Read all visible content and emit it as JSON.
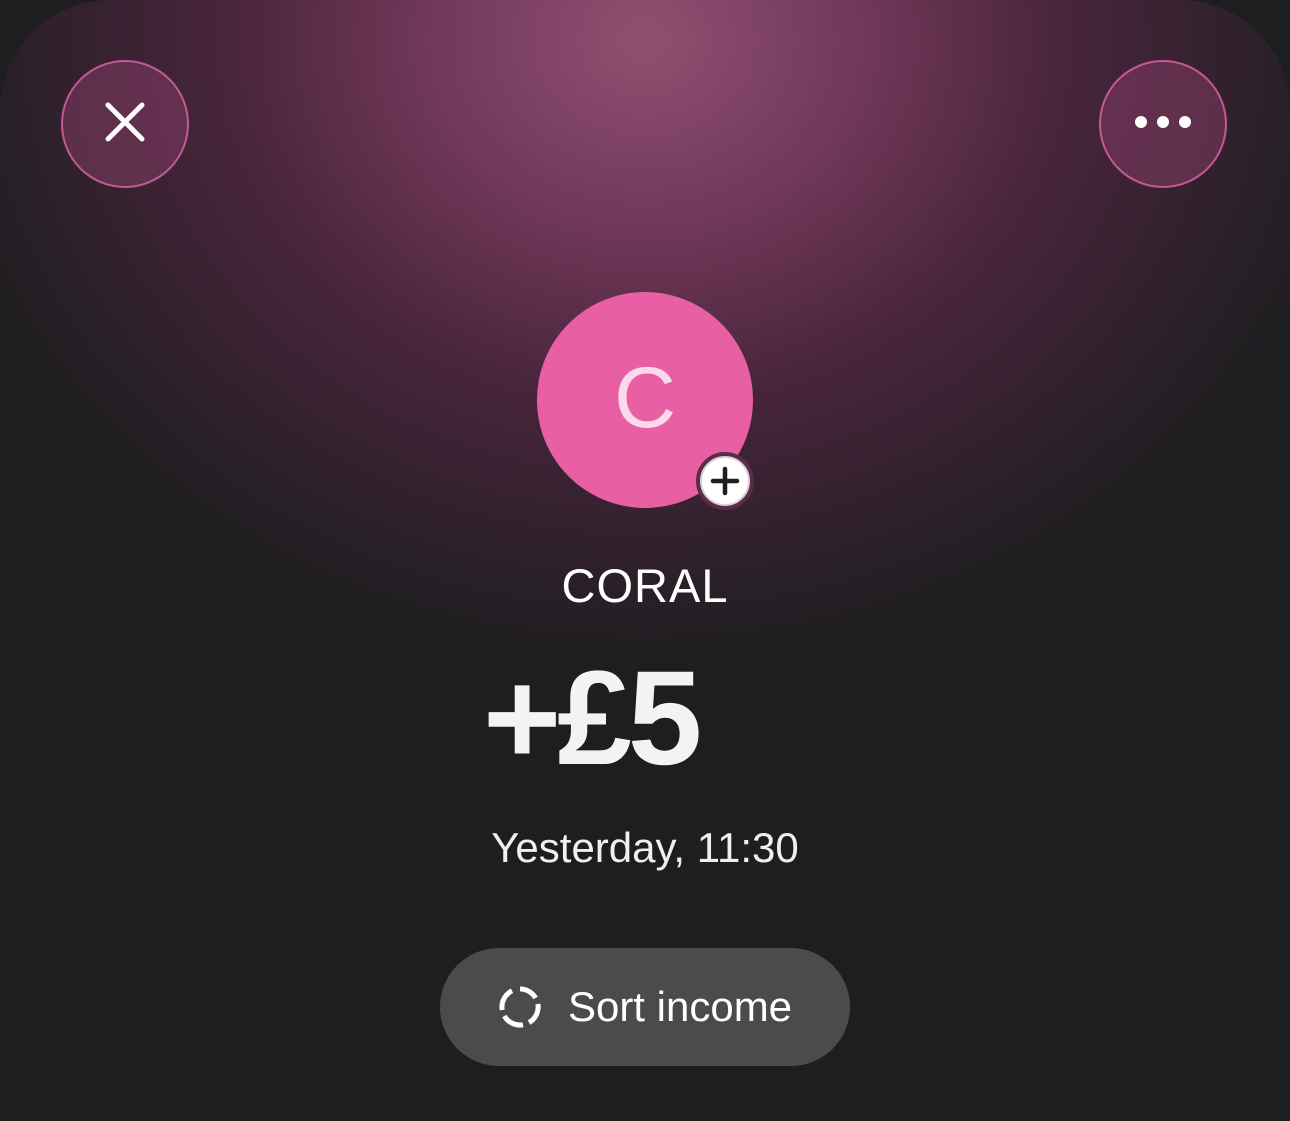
{
  "header": {
    "close_icon": "close-icon",
    "more_icon": "more-horizontal-icon"
  },
  "merchant": {
    "avatar_letter": "C",
    "avatar_color": "#e85fa4",
    "add_icon": "plus-icon",
    "name": "CORAL"
  },
  "transaction": {
    "amount": "+£5",
    "timestamp": "Yesterday, 11:30"
  },
  "actions": {
    "sort_icon": "loading-spinner-icon",
    "sort_label": "Sort income"
  },
  "colors": {
    "accent": "#e85fa4",
    "background_top": "#8a4a6e",
    "background_bottom": "#1e1e20",
    "button_bg": "#4b4b4d"
  }
}
